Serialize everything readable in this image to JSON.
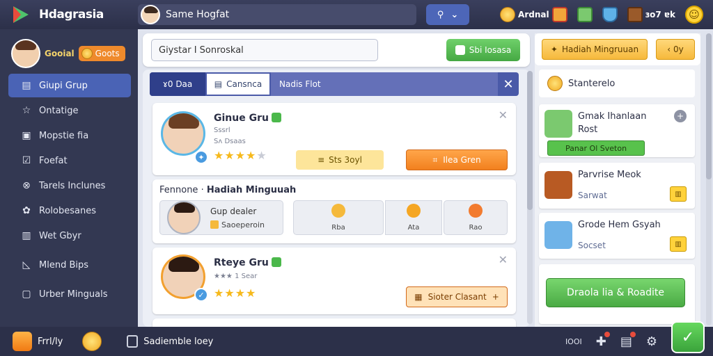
{
  "topbar": {
    "app_title": "Hdagrasia",
    "search_value": "Same Hogfat",
    "stats": [
      {
        "label": "Ardnal",
        "icon": "coin-icon"
      },
      {
        "label": "",
        "icon": "gift-icon"
      },
      {
        "label": "",
        "icon": "trophy-icon"
      },
      {
        "label": "ɜo7 ɐk",
        "icon": "chest-icon"
      }
    ]
  },
  "sidebar": {
    "profile_name": "Gooial",
    "profile_badge": "Goots",
    "items": [
      {
        "label": "Giupi Grup",
        "icon": "▤",
        "active": true
      },
      {
        "label": "Ontatige",
        "icon": "☆"
      },
      {
        "label": "Mopstie fia",
        "icon": "▣"
      },
      {
        "label": "Foefat",
        "icon": "☑"
      },
      {
        "label": "Tarels Inclunes",
        "icon": "⊗"
      },
      {
        "label": "Rolobesanes",
        "icon": "✿"
      },
      {
        "label": "Wet Gbyr",
        "icon": "▥"
      },
      {
        "label": "Mlend Bips",
        "icon": "◺"
      },
      {
        "label": "Urber Minguals",
        "icon": "▢"
      }
    ]
  },
  "main": {
    "filter_value": "Giystar I Sonroskal",
    "green_button": "Sbi Iosasa",
    "tabs": {
      "first": "ɤ0 Daa",
      "selected": "Cansnca",
      "last": "Nadis Flot"
    },
    "card1": {
      "name": "Ginue Gru",
      "sub1": "Sssrl",
      "sub2": "Sʌ Dsaas",
      "rating": 4,
      "yellow_pill": "Sts 3oyl",
      "orange_pill": "Ilea Gren"
    },
    "mid": {
      "title_prefix": "Fennone",
      "title": "Hadiah Minguuah",
      "person_name": "Gup dealer",
      "person_sub": "Saoeperoin",
      "options": [
        {
          "label": "Rba",
          "color": "#f5b93b"
        },
        {
          "label": "Ata",
          "color": "#f5a623"
        },
        {
          "label": "Rao",
          "color": "#f27b2f"
        }
      ]
    },
    "card2": {
      "name": "Rteye Gru",
      "sub1": "1 Sear",
      "rating": 4,
      "orange_pill": "Sioter Clasant"
    }
  },
  "right": {
    "top_button": "Hadiah Mingruuan",
    "top_button2": "0y",
    "header": "Stanterelo",
    "items": [
      {
        "title": "Gmak Ihanlaan Rost",
        "tag": "Panar Ol Sveton"
      },
      {
        "title": "Parvrise Meok",
        "sub": "Sarwat"
      },
      {
        "title": "Grode Hem Gsyah",
        "sub": "Socset"
      }
    ],
    "cta": "Draola lia & Roadite"
  },
  "bottombar": {
    "left_label": "Frrl/ly",
    "middle_label": "Sadiemble loey",
    "status": "IOOI"
  },
  "colors": {
    "topbar": "#2c3049",
    "sidebar": "#333852",
    "accent_blue": "#4a63b5",
    "accent_green": "#4aaa44",
    "accent_orange": "#f2801e"
  }
}
